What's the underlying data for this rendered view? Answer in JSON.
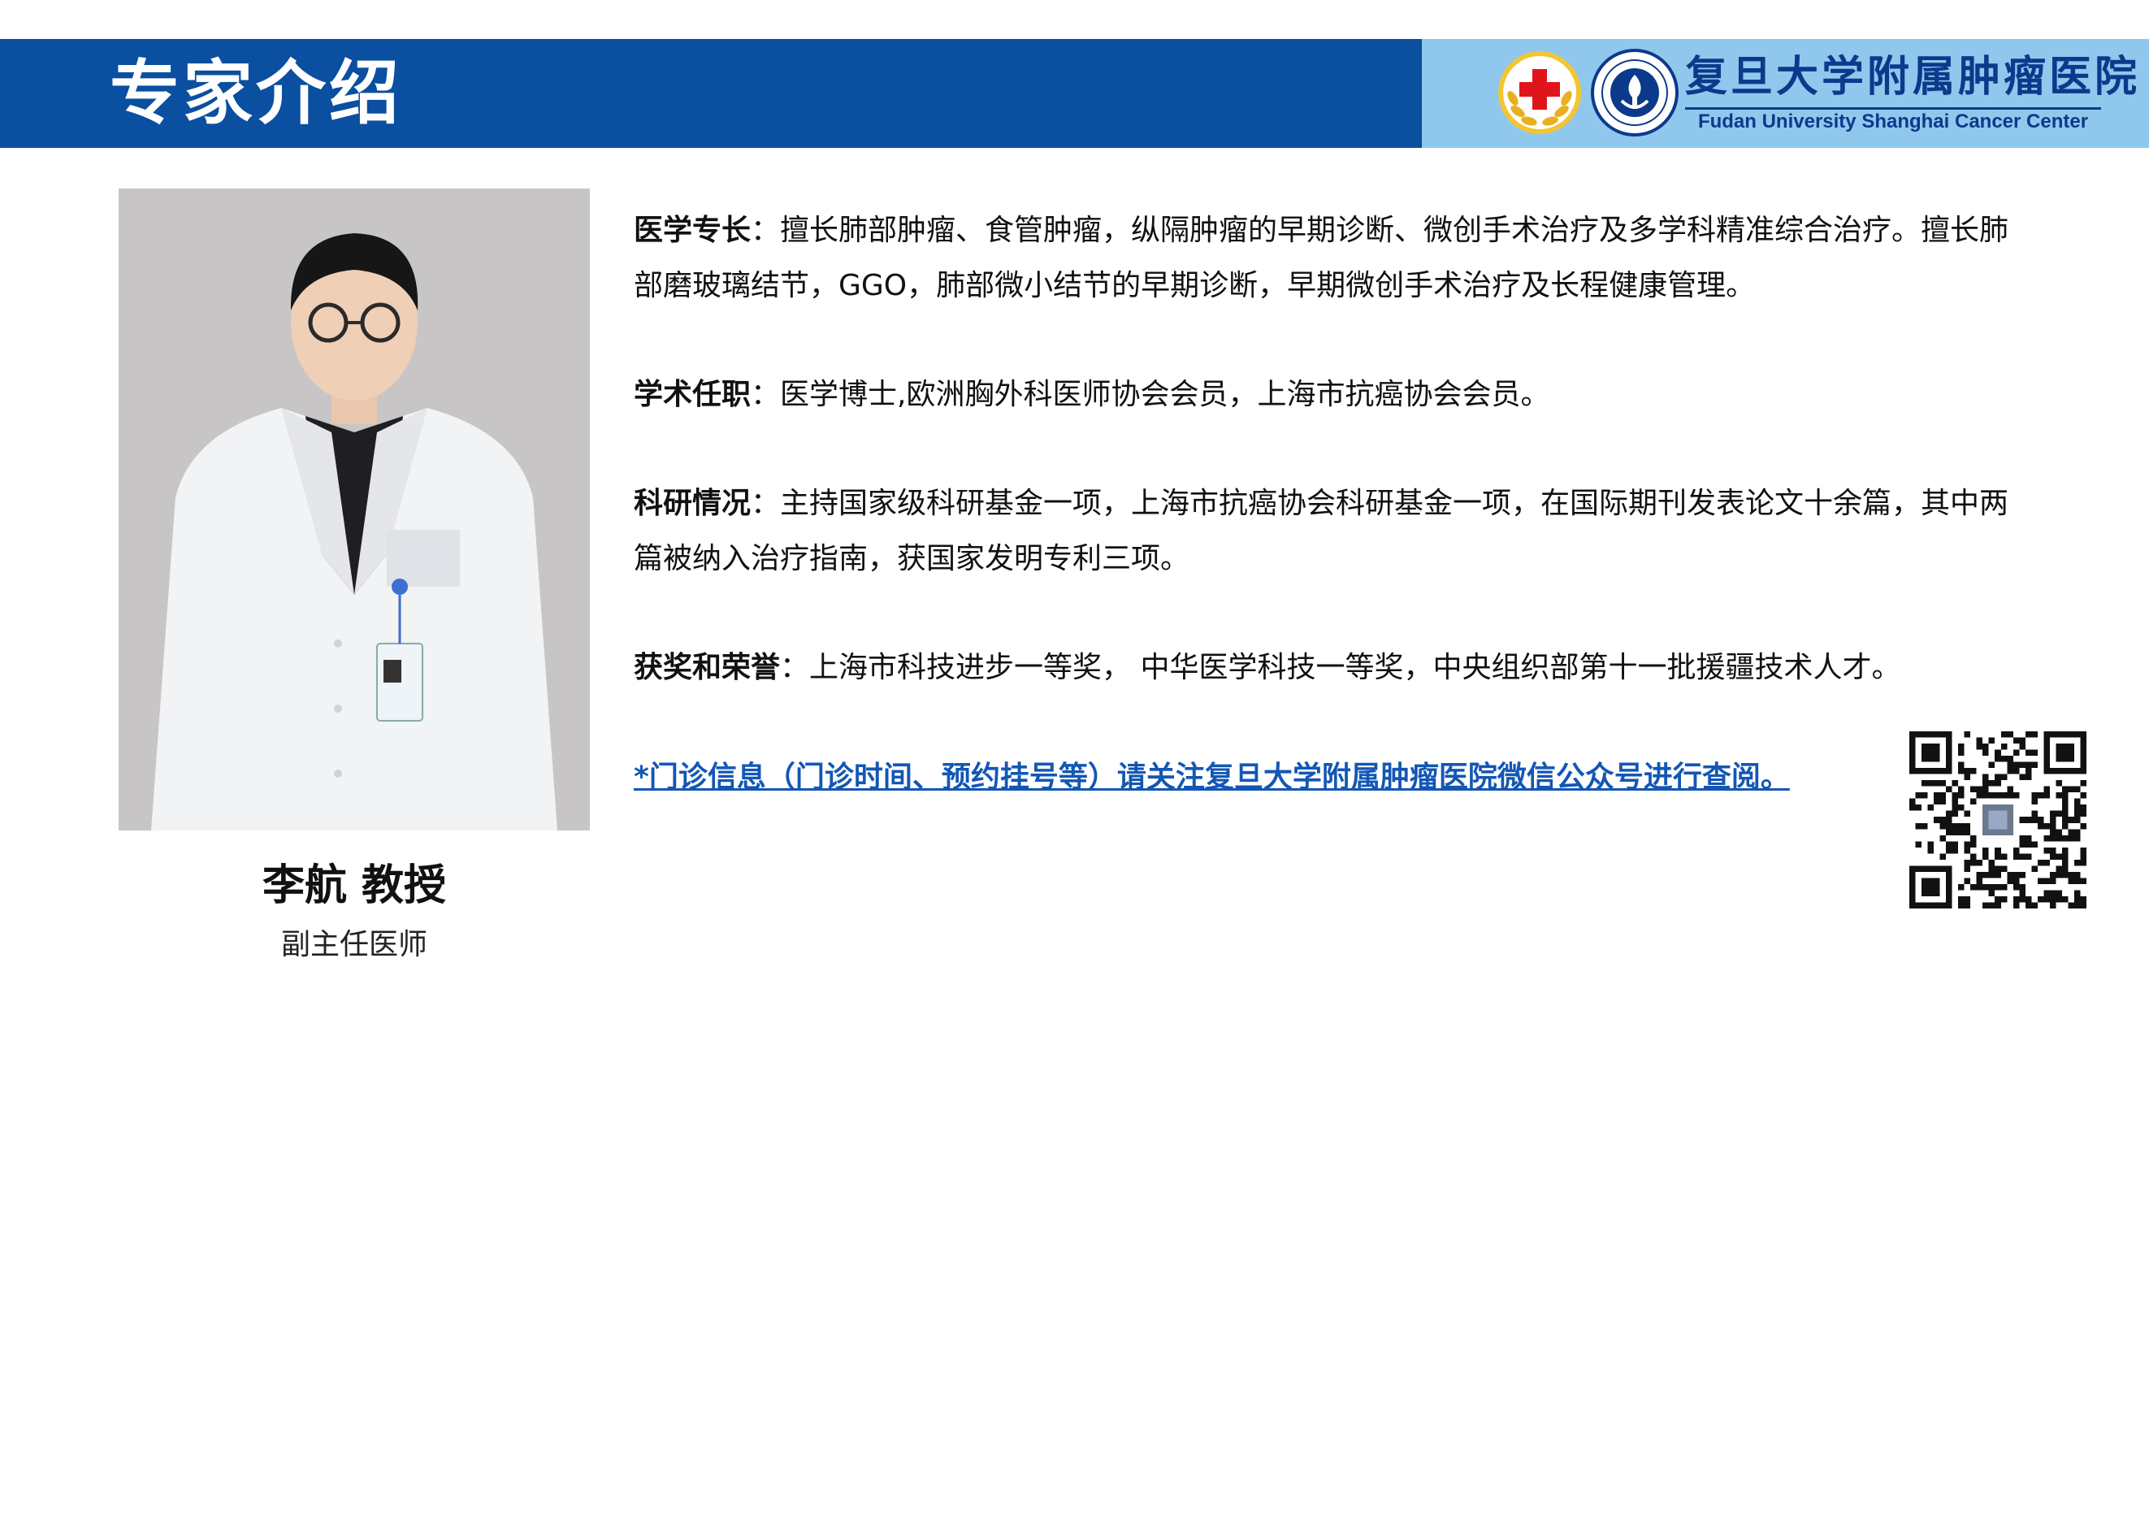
{
  "header": {
    "title": "专家介绍",
    "hospital_name_cn": "复旦大学附属肿瘤医院",
    "hospital_name_en": "Fudan University Shanghai Cancer Center"
  },
  "expert": {
    "name": "李航 教授",
    "position": "副主任医师"
  },
  "sections": [
    {
      "label": "医学专长",
      "text": "：擅长肺部肿瘤、食管肿瘤，纵隔肿瘤的早期诊断、微创手术治疗及多学科精准综合治疗。擅长肺部磨玻璃结节，GGO，肺部微小结节的早期诊断，早期微创手术治疗及长程健康管理。"
    },
    {
      "label": "学术任职",
      "text": "：医学博士,欧洲胸外科医师协会会员，上海市抗癌协会会员。"
    },
    {
      "label": "科研情况",
      "text": "：主持国家级科研基金一项，上海市抗癌协会科研基金一项，在国际期刊发表论文十余篇，其中两篇被纳入治疗指南，获国家发明专利三项。"
    },
    {
      "label": "获奖和荣誉",
      "text": "：上海市科技进步一等奖， 中华医学科技一等奖，中央组织部第十一批援疆技术人才。"
    }
  ],
  "notice": "*门诊信息（门诊时间、预约挂号等）请关注复旦大学附属肿瘤医院微信公众号进行查阅。",
  "colors": {
    "header_blue": "#0a4fa0",
    "header_light_blue": "#8fc8ec",
    "notice_blue": "#1357b5",
    "logo_navy": "#0b3a8c",
    "red_cross": "#e0151b"
  },
  "icons": {
    "red_cross_logo": "red-cross-emblem",
    "hospital_logo": "hospital-emblem",
    "qr_code": "wechat-qr-code"
  }
}
